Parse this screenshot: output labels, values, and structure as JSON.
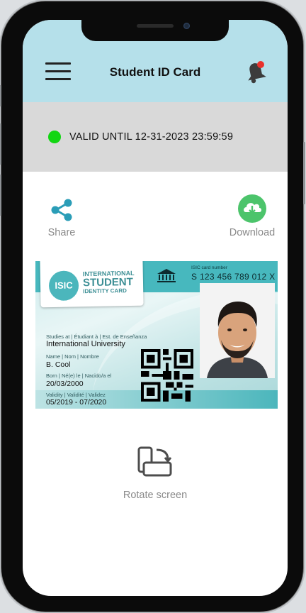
{
  "header": {
    "title": "Student ID Card"
  },
  "status": {
    "text": "VALID UNTIL 12-31-2023 23:59:59",
    "indicator_color": "#12d612"
  },
  "actions": {
    "share_label": "Share",
    "download_label": "Download"
  },
  "card": {
    "logo_abbr": "ISIC",
    "logo_line1": "INTERNATIONAL",
    "logo_line2": "STUDENT",
    "logo_line3": "IDENTITY CARD",
    "unesco_label": "UNESCO",
    "card_number_label": "ISIC card number",
    "card_number": "S 123 456 789 012 X",
    "studies_label": "Studies at | Étudiant à | Est. de Enseñanza",
    "studies_value": "International University",
    "name_label": "Name | Nom | Nombre",
    "name_value": "B. Cool",
    "born_label": "Born | Né(e) le | Nacido/a el",
    "born_value": "20/03/2000",
    "validity_label": "Validity | Validité | Validez",
    "validity_value": "05/2019 - 07/2020"
  },
  "rotate": {
    "label": "Rotate screen"
  },
  "colors": {
    "header_bg": "#b5e0ea",
    "accent": "#2a9db7",
    "download_green": "#4cc46b",
    "card_teal": "#47b8be"
  }
}
